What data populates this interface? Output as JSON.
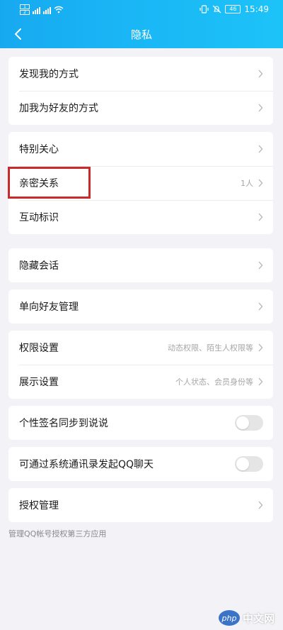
{
  "status_bar": {
    "time": "15:49",
    "battery": "46"
  },
  "header": {
    "title": "隐私"
  },
  "groups": [
    {
      "rows": [
        {
          "label": "发现我的方式"
        },
        {
          "label": "加我为好友的方式"
        }
      ]
    },
    {
      "rows": [
        {
          "label": "特别关心"
        },
        {
          "label": "亲密关系",
          "value": "1人"
        },
        {
          "label": "互动标识"
        }
      ]
    },
    {
      "rows": [
        {
          "label": "隐藏会话"
        }
      ]
    },
    {
      "rows": [
        {
          "label": "单向好友管理"
        }
      ]
    },
    {
      "rows": [
        {
          "label": "权限设置",
          "value": "动态权限、陌生人权限等"
        },
        {
          "label": "展示设置",
          "value": "个人状态、会员身份等"
        }
      ]
    },
    {
      "rows": [
        {
          "label": "个性签名同步到说说",
          "toggle": false
        }
      ]
    },
    {
      "rows": [
        {
          "label": "可通过系统通讯录发起QQ聊天",
          "toggle": false
        }
      ]
    },
    {
      "rows": [
        {
          "label": "授权管理"
        }
      ]
    }
  ],
  "footnote": "管理QQ帐号授权第三方应用",
  "watermark": {
    "logo": "php",
    "text": "中文网"
  },
  "colors": {
    "header_start": "#17a9f0",
    "header_end": "#1cc3f8",
    "highlight": "#c92a2a"
  }
}
